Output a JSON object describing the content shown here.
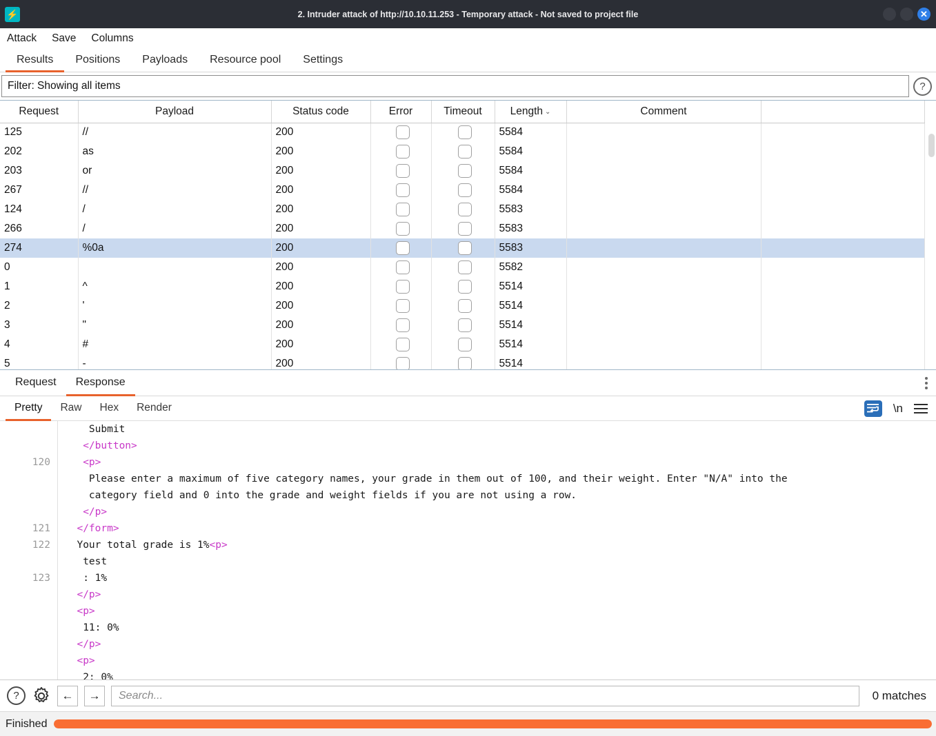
{
  "window": {
    "title": "2. Intruder attack of http://10.10.11.253 - Temporary attack - Not saved to project file",
    "logo_glyph": "⚡",
    "close_glyph": "✕"
  },
  "menubar": {
    "items": [
      "Attack",
      "Save",
      "Columns"
    ]
  },
  "main_tabs": [
    {
      "label": "Results",
      "active": true
    },
    {
      "label": "Positions",
      "active": false
    },
    {
      "label": "Payloads",
      "active": false
    },
    {
      "label": "Resource pool",
      "active": false
    },
    {
      "label": "Settings",
      "active": false
    }
  ],
  "filter": {
    "text": "Filter: Showing all items",
    "help_glyph": "?"
  },
  "results_table": {
    "columns": [
      "Request",
      "Payload",
      "Status code",
      "Error",
      "Timeout",
      "Length",
      "Comment"
    ],
    "sorted_column": "Length",
    "sort_caret": "⌄",
    "rows": [
      {
        "request": "125",
        "payload": "//",
        "status": "200",
        "error": false,
        "timeout": false,
        "length": "5584",
        "comment": "",
        "selected": false
      },
      {
        "request": "202",
        "payload": "as",
        "status": "200",
        "error": false,
        "timeout": false,
        "length": "5584",
        "comment": "",
        "selected": false
      },
      {
        "request": "203",
        "payload": "or",
        "status": "200",
        "error": false,
        "timeout": false,
        "length": "5584",
        "comment": "",
        "selected": false
      },
      {
        "request": "267",
        "payload": "//",
        "status": "200",
        "error": false,
        "timeout": false,
        "length": "5584",
        "comment": "",
        "selected": false
      },
      {
        "request": "124",
        "payload": "/",
        "status": "200",
        "error": false,
        "timeout": false,
        "length": "5583",
        "comment": "",
        "selected": false
      },
      {
        "request": "266",
        "payload": "/",
        "status": "200",
        "error": false,
        "timeout": false,
        "length": "5583",
        "comment": "",
        "selected": false
      },
      {
        "request": "274",
        "payload": "%0a",
        "status": "200",
        "error": false,
        "timeout": false,
        "length": "5583",
        "comment": "",
        "selected": true
      },
      {
        "request": "0",
        "payload": "",
        "status": "200",
        "error": false,
        "timeout": false,
        "length": "5582",
        "comment": "",
        "selected": false
      },
      {
        "request": "1",
        "payload": "^",
        "status": "200",
        "error": false,
        "timeout": false,
        "length": "5514",
        "comment": "",
        "selected": false
      },
      {
        "request": "2",
        "payload": "'",
        "status": "200",
        "error": false,
        "timeout": false,
        "length": "5514",
        "comment": "",
        "selected": false
      },
      {
        "request": "3",
        "payload": "\"",
        "status": "200",
        "error": false,
        "timeout": false,
        "length": "5514",
        "comment": "",
        "selected": false
      },
      {
        "request": "4",
        "payload": "#",
        "status": "200",
        "error": false,
        "timeout": false,
        "length": "5514",
        "comment": "",
        "selected": false
      },
      {
        "request": "5",
        "payload": "-",
        "status": "200",
        "error": false,
        "timeout": false,
        "length": "5514",
        "comment": "",
        "selected": false
      }
    ]
  },
  "message_tabs": [
    {
      "label": "Request",
      "active": false
    },
    {
      "label": "Response",
      "active": true
    }
  ],
  "view_tabs": [
    {
      "label": "Pretty",
      "active": true
    },
    {
      "label": "Raw",
      "active": false
    },
    {
      "label": "Hex",
      "active": false
    },
    {
      "label": "Render",
      "active": false
    }
  ],
  "view_icons": {
    "wordwrap_label": "↵",
    "newline_label": "\\n",
    "menu_label": "menu"
  },
  "response_body": {
    "lines": [
      {
        "num": "",
        "segments": [
          {
            "t": "    Submit",
            "k": "txt"
          }
        ]
      },
      {
        "num": "",
        "segments": [
          {
            "t": "   </",
            "k": "tag"
          },
          {
            "t": "button",
            "k": "tag"
          },
          {
            "t": ">",
            "k": "tag"
          }
        ]
      },
      {
        "num": "120",
        "segments": [
          {
            "t": "   <",
            "k": "tag"
          },
          {
            "t": "p",
            "k": "tag"
          },
          {
            "t": ">",
            "k": "tag"
          }
        ]
      },
      {
        "num": "",
        "segments": [
          {
            "t": "    Please enter a maximum of five category names, your grade in them out of 100, and their weight. Enter \"N/A\" into the",
            "k": "txt"
          }
        ]
      },
      {
        "num": "",
        "segments": [
          {
            "t": "    category field and 0 into the grade and weight fields if you are not using a row.",
            "k": "txt"
          }
        ]
      },
      {
        "num": "",
        "segments": [
          {
            "t": "   </",
            "k": "tag"
          },
          {
            "t": "p",
            "k": "tag"
          },
          {
            "t": ">",
            "k": "tag"
          }
        ]
      },
      {
        "num": "121",
        "segments": [
          {
            "t": "  </",
            "k": "tag"
          },
          {
            "t": "form",
            "k": "tag"
          },
          {
            "t": ">",
            "k": "tag"
          }
        ]
      },
      {
        "num": "122",
        "segments": [
          {
            "t": "  Your total grade is 1%",
            "k": "txt"
          },
          {
            "t": "<p>",
            "k": "tag"
          }
        ]
      },
      {
        "num": "",
        "segments": [
          {
            "t": "   test",
            "k": "txt"
          }
        ]
      },
      {
        "num": "123",
        "segments": [
          {
            "t": "   : 1%",
            "k": "txt"
          }
        ]
      },
      {
        "num": "",
        "segments": [
          {
            "t": "  </p>",
            "k": "tag"
          }
        ]
      },
      {
        "num": "",
        "segments": [
          {
            "t": "  <p>",
            "k": "tag"
          }
        ]
      },
      {
        "num": "",
        "segments": [
          {
            "t": "   11: 0%",
            "k": "txt"
          }
        ]
      },
      {
        "num": "",
        "segments": [
          {
            "t": "  </p>",
            "k": "tag"
          }
        ]
      },
      {
        "num": "",
        "segments": [
          {
            "t": "  <p>",
            "k": "tag"
          }
        ]
      },
      {
        "num": "",
        "segments": [
          {
            "t": "   2: 0%",
            "k": "txt"
          }
        ]
      }
    ]
  },
  "search_bar": {
    "help_glyph": "?",
    "gear_name": "settings",
    "prev_glyph": "←",
    "next_glyph": "→",
    "placeholder": "Search...",
    "matches": "0 matches"
  },
  "status_bar": {
    "label": "Finished",
    "progress_percent": 100,
    "progress_color": "#f96d33"
  },
  "colors": {
    "accent": "#e8622c",
    "titlebar": "#2b2e35",
    "selection": "#c9d9ef",
    "tag": "#c838c8"
  }
}
